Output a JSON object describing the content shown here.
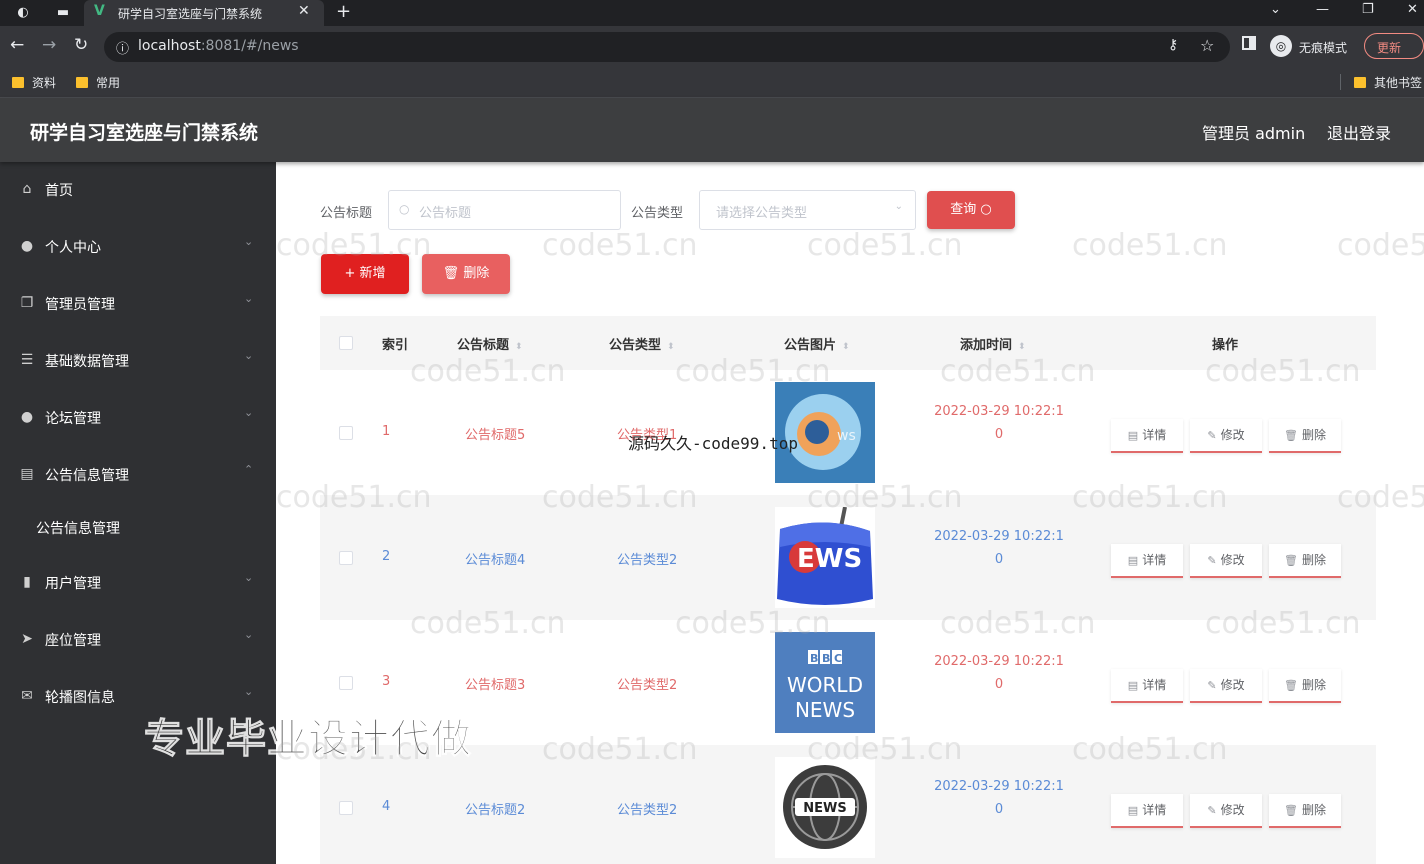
{
  "browser": {
    "tab_title": "研学自习室选座与门禁系统",
    "url_host": "localhost",
    "url_rest": ":8081/#/news",
    "incognito_label": "无痕模式",
    "update_label": "更新",
    "bookmarks": [
      "资料",
      "常用"
    ],
    "other_bookmarks": "其他书签"
  },
  "header": {
    "app_title": "研学自习室选座与门禁系统",
    "user": "管理员 admin",
    "logout": "退出登录"
  },
  "sidebar": {
    "items": [
      {
        "label": "首页",
        "icon": "home-icon"
      },
      {
        "label": "个人中心",
        "icon": "user-icon"
      },
      {
        "label": "管理员管理",
        "icon": "copy-icon"
      },
      {
        "label": "基础数据管理",
        "icon": "menu-icon"
      },
      {
        "label": "论坛管理",
        "icon": "bulb-icon"
      },
      {
        "label": "公告信息管理",
        "icon": "message-icon"
      },
      {
        "label": "用户管理",
        "icon": "bar-chart-icon"
      },
      {
        "label": "座位管理",
        "icon": "send-icon"
      },
      {
        "label": "轮播图信息",
        "icon": "mail-icon"
      }
    ],
    "submenu": {
      "label": "公告信息管理"
    },
    "overlay": "专业毕业设计代做"
  },
  "search": {
    "title_label": "公告标题",
    "title_placeholder": "公告标题",
    "type_label": "公告类型",
    "type_placeholder": "请选择公告类型",
    "query_button": "查询"
  },
  "actions": {
    "add": "新增",
    "delete": "删除"
  },
  "table": {
    "headers": {
      "index": "索引",
      "title": "公告标题",
      "type": "公告类型",
      "image": "公告图片",
      "time": "添加时间",
      "ops": "操作"
    },
    "rows": [
      {
        "index": "1",
        "title": "公告标题5",
        "type": "公告类型1",
        "time1": "2022-03-29 10:22:1",
        "time2": "0",
        "image": "news-globe"
      },
      {
        "index": "2",
        "title": "公告标题4",
        "type": "公告类型2",
        "time1": "2022-03-29 10:22:1",
        "time2": "0",
        "image": "news-microphone"
      },
      {
        "index": "3",
        "title": "公告标题3",
        "type": "公告类型2",
        "time1": "2022-03-29 10:22:1",
        "time2": "0",
        "image": "bbc-world-news"
      },
      {
        "index": "4",
        "title": "公告标题2",
        "type": "公告类型2",
        "time1": "2022-03-29 10:22:1",
        "time2": "0",
        "image": "news-globe-circle"
      }
    ],
    "ops": {
      "detail": "详情",
      "edit": "修改",
      "delete": "删除"
    }
  },
  "watermark": "code51.cn",
  "center_watermark": "源码久久-code99.top",
  "colors": {
    "header_bg": "#3d3e40",
    "sidebar_bg": "#2f3033",
    "accent_red": "#e04f4f",
    "link_blue": "#5b8bd6"
  }
}
